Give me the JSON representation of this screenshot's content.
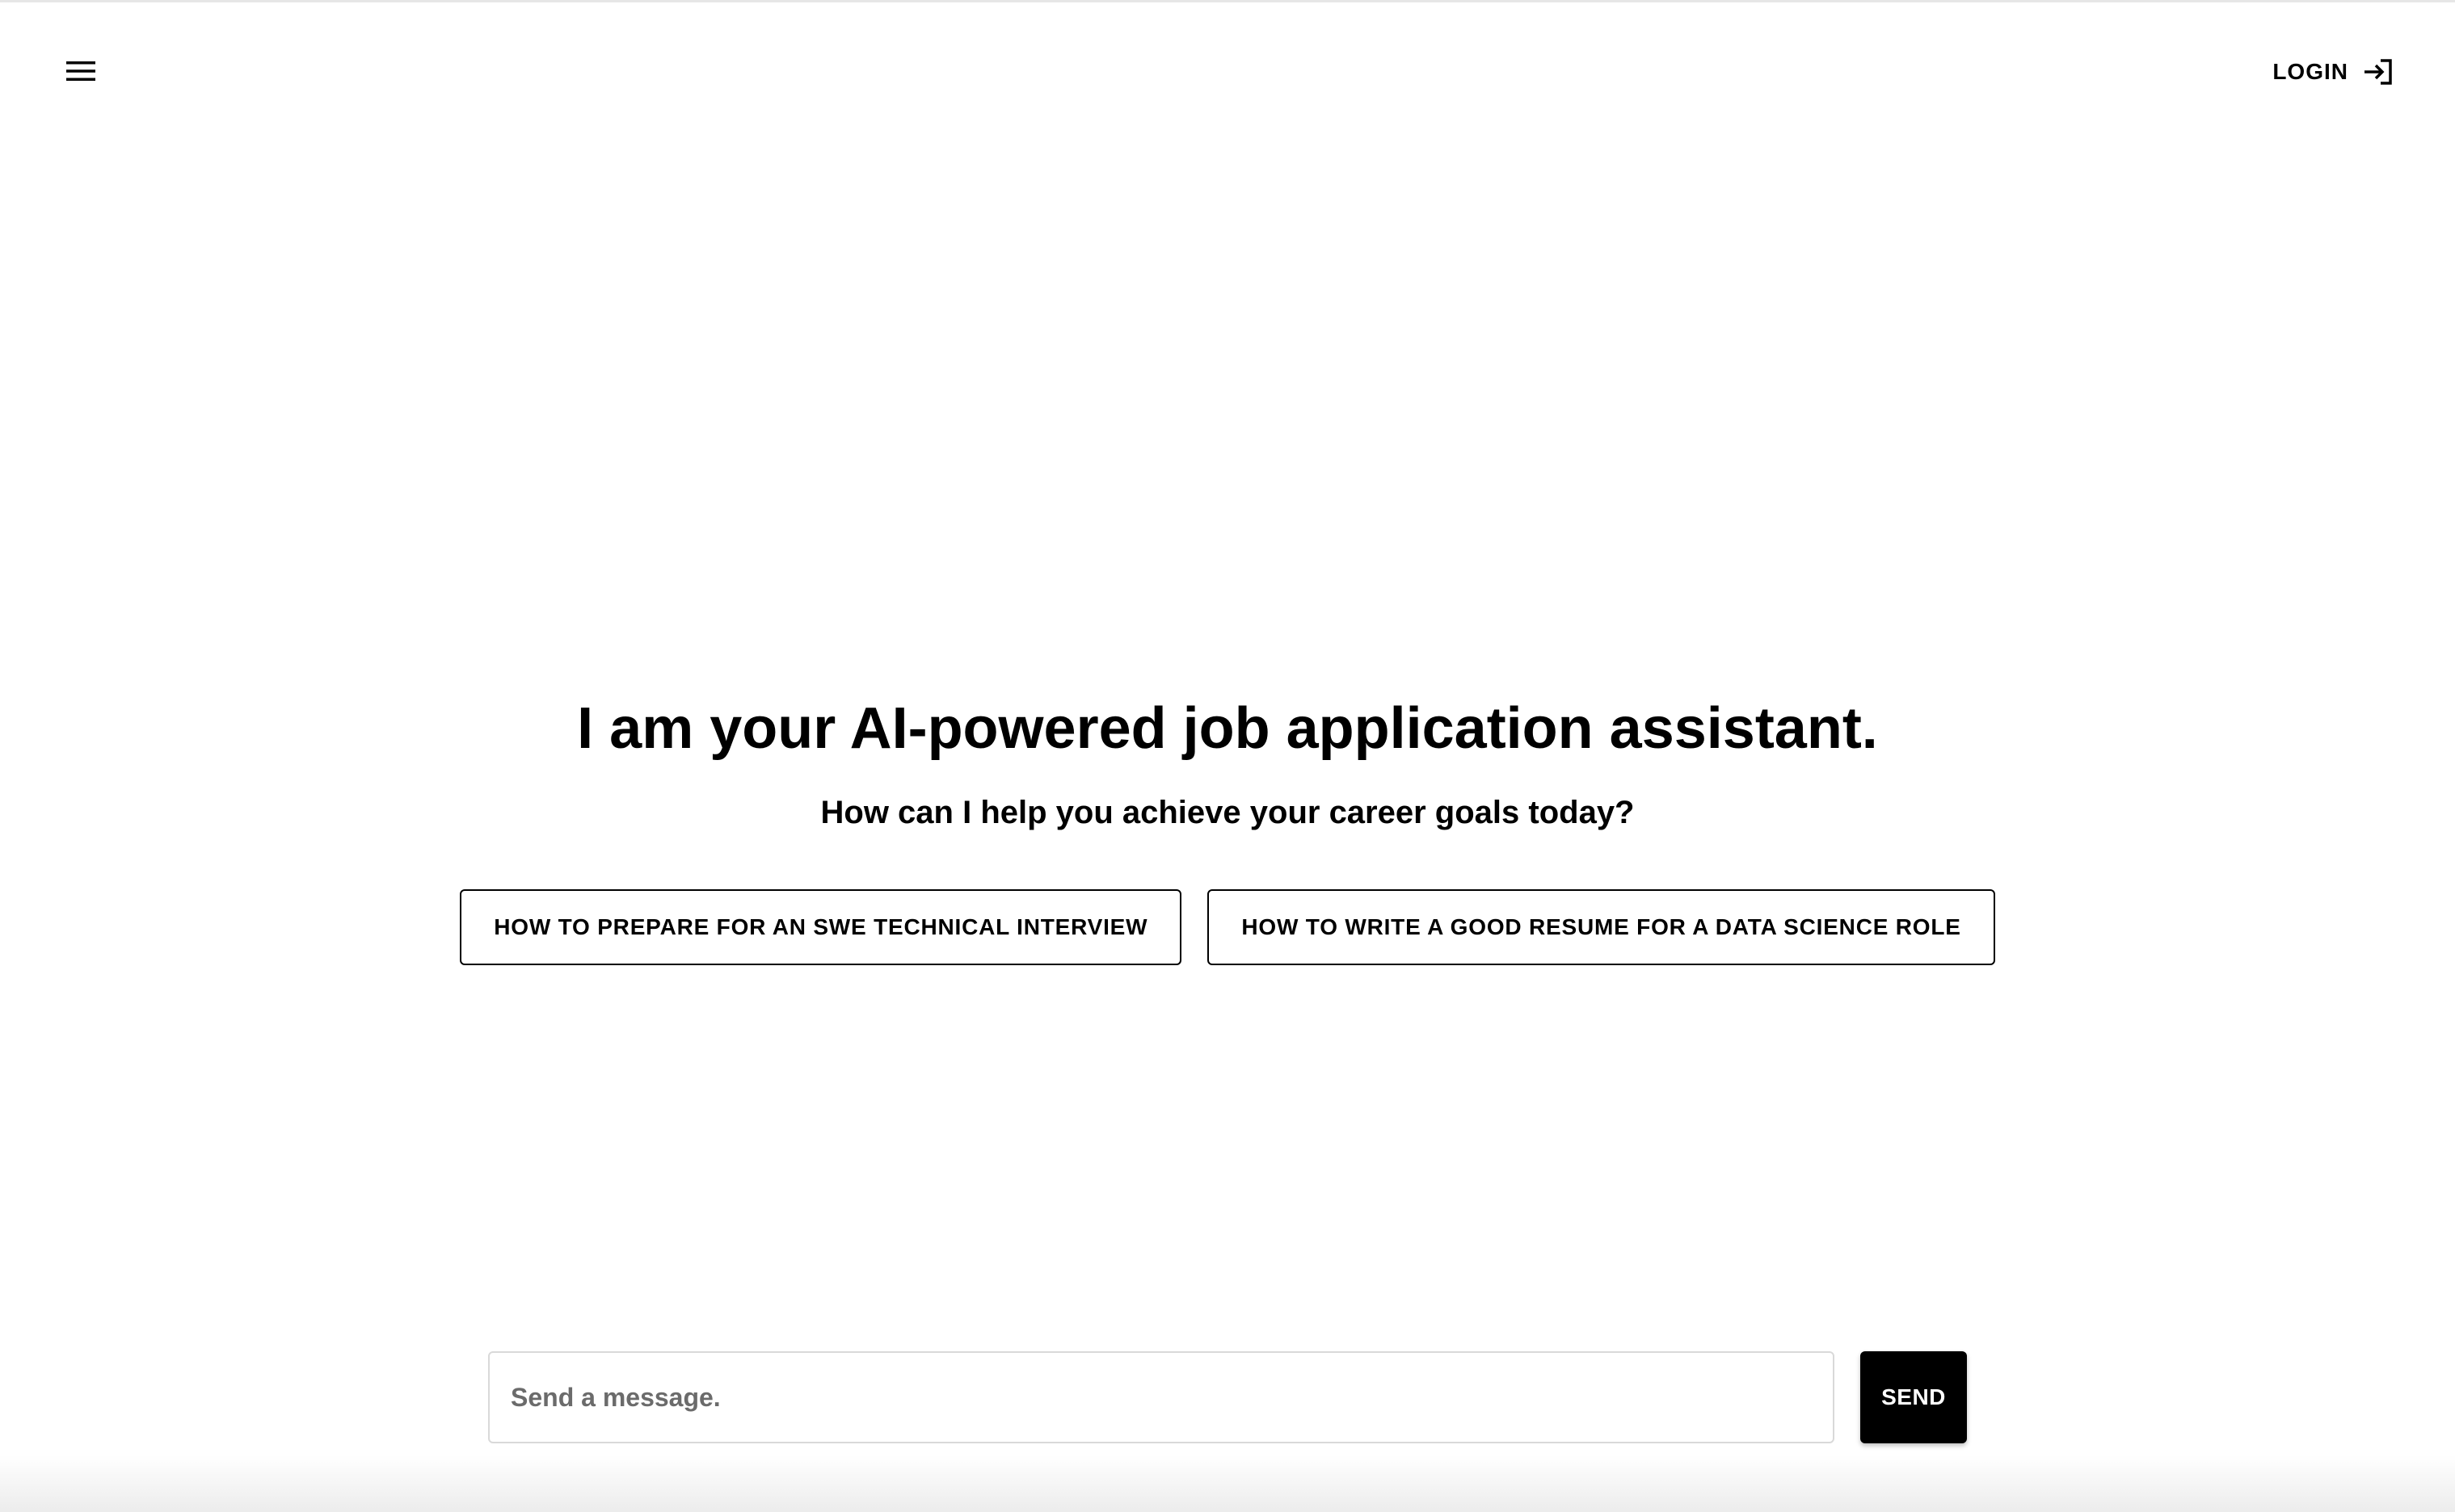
{
  "header": {
    "menu_icon": "hamburger-menu-icon",
    "login_label": "LOGIN",
    "login_icon": "login-arrow-icon"
  },
  "main": {
    "headline": "I am your AI-powered job application assistant.",
    "subheadline": "How can I help you achieve your career goals today?",
    "suggestions": [
      {
        "label": "HOW TO PREPARE FOR AN SWE TECHNICAL INTERVIEW"
      },
      {
        "label": "HOW TO WRITE A GOOD RESUME FOR A DATA SCIENCE ROLE"
      }
    ]
  },
  "composer": {
    "placeholder": "Send a message.",
    "value": "",
    "send_label": "SEND"
  },
  "colors": {
    "text": "#000000",
    "background": "#ffffff",
    "send_button": "#000000",
    "input_border": "#d9d9d9"
  }
}
